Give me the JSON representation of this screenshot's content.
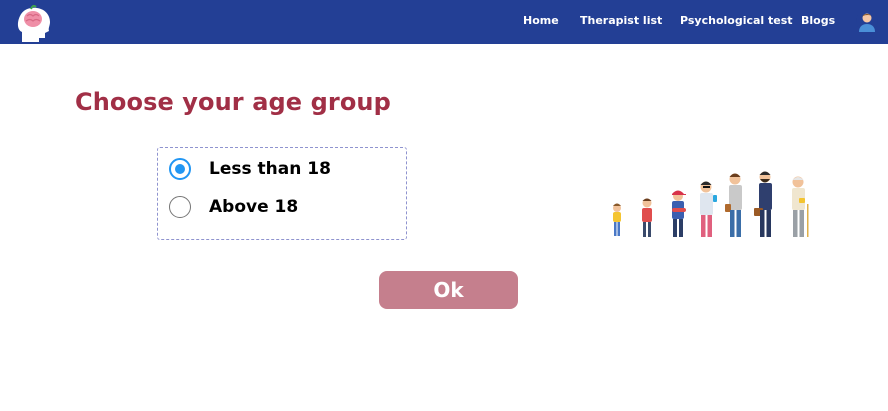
{
  "navbar": {
    "logo_icon": "brain-head-logo-icon",
    "links": [
      {
        "label": "Home"
      },
      {
        "label": "Therapist list"
      },
      {
        "label": "Psychological test"
      },
      {
        "label": "Blogs"
      }
    ],
    "avatar_icon": "user-avatar-icon",
    "background": "#233f95"
  },
  "main": {
    "title": "Choose your age group",
    "title_color": "#a12f46",
    "options": [
      {
        "label": "Less than 18",
        "checked": true
      },
      {
        "label": "Above 18",
        "checked": false
      }
    ],
    "illustration": "age-progression-people-illustration",
    "ok_label": "Ok",
    "ok_color": "#c57f8d",
    "radio_accent": "#2196f3"
  }
}
